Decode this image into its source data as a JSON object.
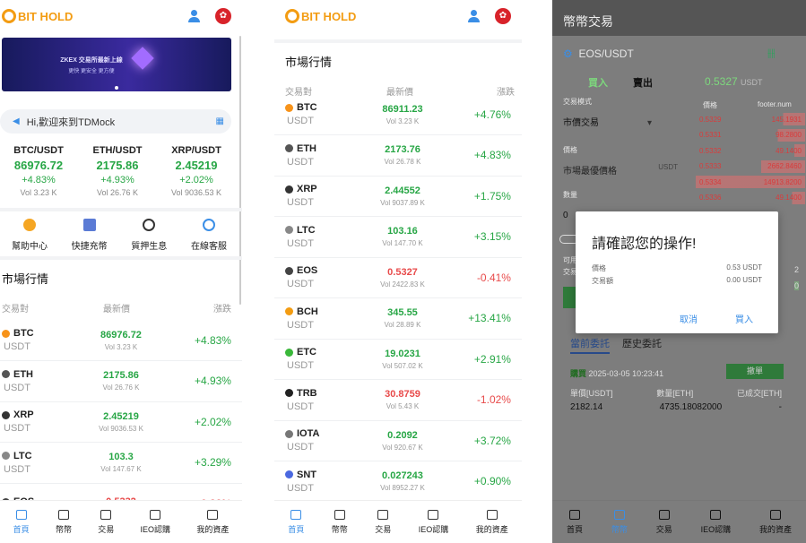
{
  "p1": {
    "logo": "BIT HOLD",
    "flag_glyph": "✿",
    "banner_text": "ZKEX 交易所最新上線",
    "banner_sub": "更快 更安全 更方便",
    "notice": "Hi,歡迎來到TDMock",
    "tickers": [
      {
        "sym": "BTC/USDT",
        "price": "86976.72",
        "change": "+4.83%",
        "vol": "Vol 3.23 K"
      },
      {
        "sym": "ETH/USDT",
        "price": "2175.86",
        "change": "+4.93%",
        "vol": "Vol 26.76 K"
      },
      {
        "sym": "XRP/USDT",
        "price": "2.45219",
        "change": "+2.02%",
        "vol": "Vol 9036.53 K"
      }
    ],
    "shortcuts": [
      "幫助中心",
      "快捷充幣",
      "質押生息",
      "在線客服"
    ],
    "market_title": "市場行情",
    "head": {
      "pair": "交易對",
      "price": "最新價",
      "change": "漲跌"
    },
    "rows": [
      {
        "coin": "BTC",
        "quote": "USDT",
        "price": "86976.72",
        "vol": "Vol 3.23 K",
        "change": "+4.83%",
        "dir": "up"
      },
      {
        "coin": "ETH",
        "quote": "USDT",
        "price": "2175.86",
        "vol": "Vol 26.76 K",
        "change": "+4.93%",
        "dir": "up"
      },
      {
        "coin": "XRP",
        "quote": "USDT",
        "price": "2.45219",
        "vol": "Vol 9036.53 K",
        "change": "+2.02%",
        "dir": "up"
      },
      {
        "coin": "LTC",
        "quote": "USDT",
        "price": "103.3",
        "vol": "Vol 147.67 K",
        "change": "+3.29%",
        "dir": "up"
      },
      {
        "coin": "EOS",
        "quote": "",
        "price": "0.5332",
        "vol": "",
        "change": "-0.32%",
        "dir": "dn"
      }
    ]
  },
  "p2": {
    "logo": "BIT HOLD",
    "flag_glyph": "✿",
    "market_title": "市場行情",
    "head": {
      "pair": "交易對",
      "price": "最新價",
      "change": "漲跌"
    },
    "rows": [
      {
        "coin": "BTC",
        "quote": "USDT",
        "price": "86911.23",
        "vol": "Vol 3.23 K",
        "change": "+4.76%",
        "dir": "up"
      },
      {
        "coin": "ETH",
        "quote": "USDT",
        "price": "2173.76",
        "vol": "Vol 26.78 K",
        "change": "+4.83%",
        "dir": "up"
      },
      {
        "coin": "XRP",
        "quote": "USDT",
        "price": "2.44552",
        "vol": "Vol 9037.89 K",
        "change": "+1.75%",
        "dir": "up"
      },
      {
        "coin": "LTC",
        "quote": "USDT",
        "price": "103.16",
        "vol": "Vol 147.70 K",
        "change": "+3.15%",
        "dir": "up"
      },
      {
        "coin": "EOS",
        "quote": "USDT",
        "price": "0.5327",
        "vol": "Vol 2422.83 K",
        "change": "-0.41%",
        "dir": "dn"
      },
      {
        "coin": "BCH",
        "quote": "USDT",
        "price": "345.55",
        "vol": "Vol 28.89 K",
        "change": "+13.41%",
        "dir": "up"
      },
      {
        "coin": "ETC",
        "quote": "USDT",
        "price": "19.0231",
        "vol": "Vol 507.02 K",
        "change": "+2.91%",
        "dir": "up"
      },
      {
        "coin": "TRB",
        "quote": "USDT",
        "price": "30.8759",
        "vol": "Vol 5.43 K",
        "change": "-1.02%",
        "dir": "dn"
      },
      {
        "coin": "IOTA",
        "quote": "USDT",
        "price": "0.2092",
        "vol": "Vol 920.67 K",
        "change": "+3.72%",
        "dir": "up"
      },
      {
        "coin": "SNT",
        "quote": "USDT",
        "price": "0.027243",
        "vol": "Vol 8952.27 K",
        "change": "+0.90%",
        "dir": "up"
      }
    ]
  },
  "nav": [
    "首頁",
    "幣幣",
    "交易",
    "IEO認購",
    "我的資產"
  ],
  "p3": {
    "title": "幣幣交易",
    "pair": "EOS/USDT",
    "tab_buy": "買入",
    "tab_sell": "賣出",
    "last_price": "0.5327",
    "last_unit": "USDT",
    "order_type_label": "交易模式",
    "order_type": "市價交易",
    "price_label": "價格",
    "price_placeholder": "市場最優價格",
    "price_unit": "USDT",
    "amount_label": "數量",
    "amount_value": "0",
    "avail_label": "可用",
    "trade_label": "交易",
    "ob_head": {
      "price": "價格",
      "num": "footer.num"
    },
    "asks": [
      {
        "price": "0.5329",
        "num": "145.1931"
      },
      {
        "price": "0.5331",
        "num": "98.2800"
      },
      {
        "price": "0.5332",
        "num": "49.1400"
      },
      {
        "price": "0.5333",
        "num": "2662.8460"
      },
      {
        "price": "0.5334",
        "num": "14913.8200"
      },
      {
        "price": "0.5336",
        "num": "49.1400"
      }
    ],
    "tabs": {
      "current": "當前委託",
      "history": "歷史委託"
    },
    "order": {
      "side": "購買",
      "time": "2025-03-05 10:23:41",
      "cancel": "撤單",
      "h1": "單價[USDT]",
      "h2": "數量[ETH]",
      "h3": "已成交[ETH]",
      "v1": "2182.14",
      "v2": "4735.18082000",
      "v3": "-"
    },
    "dialog": {
      "title": "請確認您的操作!",
      "l1": "價格",
      "v1": "0.53 USDT",
      "l2": "交易額",
      "v2": "0.00 USDT",
      "cancel": "取消",
      "confirm": "買入"
    }
  },
  "colors": {
    "up": "#27a645",
    "down": "#e84a4a",
    "accent": "#3a8ee6",
    "brand": "#f39c12"
  }
}
